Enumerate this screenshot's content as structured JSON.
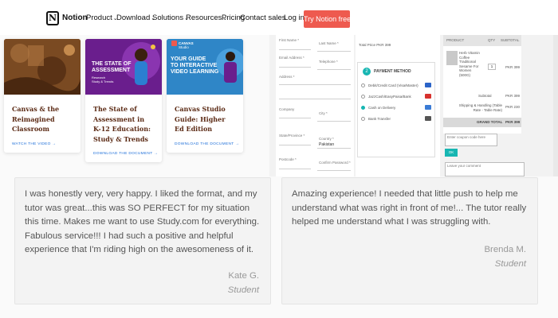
{
  "nav": {
    "brand": "Notion",
    "items": [
      {
        "label": "Product",
        "chevron": true
      },
      {
        "label": "Download",
        "chevron": true
      },
      {
        "label": "Solutions",
        "chevron": true
      },
      {
        "label": "Resources",
        "chevron": true
      },
      {
        "label": "Pricing",
        "chevron": false
      },
      {
        "label": "Contact sales",
        "chevron": false
      },
      {
        "label": "Log in",
        "chevron": false
      }
    ],
    "cta": "Try Notion free",
    "cta_color": "#ee5a4f"
  },
  "cards": [
    {
      "title": "Canvas & the Reimagined Classroom",
      "link": "WATCH THE VIDEO →",
      "thumb_lines": []
    },
    {
      "title": "The State of Assessment in K-12 Education: Study & Trends",
      "link": "DOWNLOAD THE DOCUMENT →",
      "thumb_lines": [
        "THE STATE OF",
        "ASSESSMENT",
        "Research",
        "Study & Trends"
      ]
    },
    {
      "title": "Canvas Studio Guide: Higher Ed Edition",
      "link": "DOWNLOAD THE DOCUMENT →",
      "thumb_lines": [
        "CANVAS",
        "Studio",
        "YOUR GUIDE",
        "TO INTERACTIVE",
        "VIDEO LEARNING"
      ]
    }
  ],
  "checkout": {
    "form_labels": [
      "First Name *",
      "Last Name *",
      "Email Address *",
      "Telephone *",
      "Address *",
      "Company",
      "City *",
      "State/Province *",
      "Country *",
      "Pakistan",
      "Postcode *",
      "Confirm Password *"
    ],
    "total_line": "Total Price PKR 399",
    "payment_title": "PAYMENT METHOD",
    "payment_options": [
      "Debit/Credit Card (Visa/Master)",
      "JazzCash/EasyPaisa/Bank",
      "Cash on Delivery",
      "Bank Transfer"
    ],
    "summary_headers": [
      "PRODUCT",
      "QTY",
      "SUBTOTAL"
    ],
    "product_name": "Herb Vitamin Coffee Traditional Sesame For Women (500G)",
    "product_qty": "1",
    "product_price": "PKR 399",
    "subtotal_label": "Subtotal",
    "subtotal_value": "PKR 399",
    "shipping_label": "Shipping & Handling (Table Rate - Table Rate)",
    "shipping_value": "PKR 230",
    "grand_total_label": "GRAND TOTAL",
    "grand_total_value": "PKR 399",
    "coupon_placeholder": "Enter coupon code here",
    "ok_label": "OK",
    "comment_placeholder": "Leave your comment",
    "accent": "#17b6b2"
  },
  "testimonials": [
    {
      "text": "I was honestly very, very happy. I liked the format, and my tutor was great...this was SO PERFECT for my situation this time. Makes me want to use Study.com for everything. Fabulous service!!! I had such a positive and helpful experience that I'm riding high on the awesomeness of it.",
      "name": "Kate G.",
      "role": "Student"
    },
    {
      "text": "Amazing experience! I needed that little push to help me understand what was right in front of me!... The tutor really helped me understand what I was struggling with.",
      "name": "Brenda M.",
      "role": "Student"
    }
  ]
}
